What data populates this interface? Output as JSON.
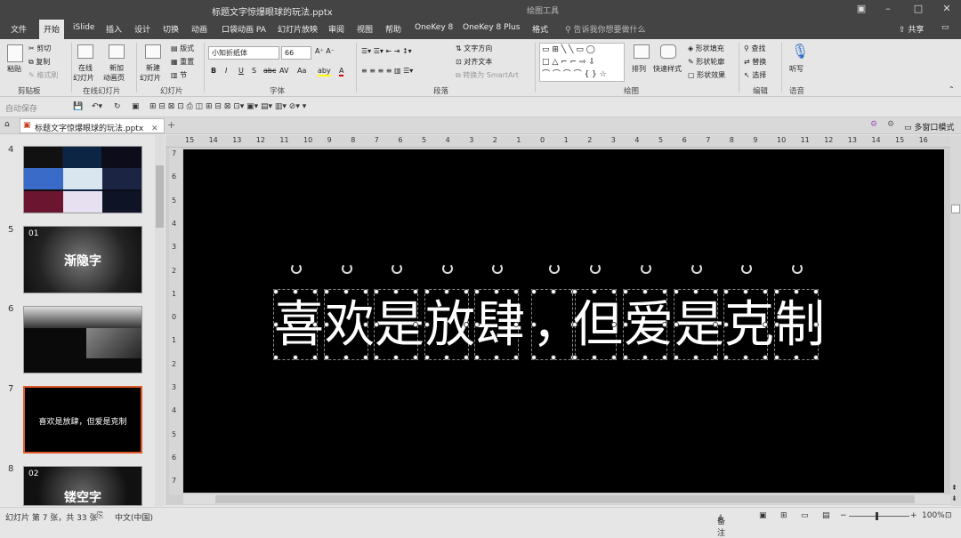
{
  "window": {
    "title": "标题文字惊爆眼球的玩法.pptx",
    "contextual_group": "绘图工具",
    "tell_me": "告诉我你想要做什么",
    "share": "共享"
  },
  "tabs": [
    "文件",
    "开始",
    "iSlide",
    "插入",
    "设计",
    "切换",
    "动画",
    "口袋动画 PA",
    "幻灯片放映",
    "审阅",
    "视图",
    "帮助",
    "OneKey 8",
    "OneKey 8 Plus",
    "格式"
  ],
  "ribbon": {
    "clipboard": {
      "label": "剪贴板",
      "paste": "粘贴",
      "cut": "剪切",
      "copy": "复制",
      "format_painter": "格式刷"
    },
    "online_slides": {
      "label": "在线幻灯片",
      "online_line1": "在线",
      "online_line2": "幻灯片",
      "new_anim_line1": "新加",
      "new_anim_line2": "动画页"
    },
    "slides": {
      "label": "幻灯片",
      "new_line1": "新建",
      "new_line2": "幻灯片",
      "layout": "版式",
      "reset": "重置",
      "section": "节"
    },
    "font": {
      "label": "字体",
      "font_name": "小知折纸体",
      "font_size": "66",
      "bold": "B",
      "italic": "I",
      "underline": "U",
      "shadow": "S",
      "strike": "abc",
      "spacing": "AV",
      "case": "Aa",
      "highlight": "aby",
      "color": "A"
    },
    "paragraph": {
      "label": "段落",
      "text_direction": "文字方向",
      "align_text": "对齐文本",
      "smartart": "转换为 SmartArt"
    },
    "drawing": {
      "label": "绘图",
      "arrange": "排列",
      "quick_styles": "快速样式",
      "fill": "形状填充",
      "outline": "形状轮廓",
      "effects": "形状效果"
    },
    "editing": {
      "label": "编辑",
      "find": "查找",
      "replace": "替换",
      "select": "选择"
    },
    "voice": {
      "label": "语音",
      "dictate": "听写"
    }
  },
  "qat": {
    "autosave": "自动保存"
  },
  "doc_tab": {
    "file": "标题文字惊爆眼球的玩法.pptx",
    "multi_window": "多窗口模式"
  },
  "thumbnails": [
    {
      "num": "4"
    },
    {
      "num": "5",
      "tag": "01",
      "title": "渐隐字"
    },
    {
      "num": "6"
    },
    {
      "num": "7",
      "title": "喜欢是放肆，但爱是克制"
    },
    {
      "num": "8",
      "tag": "02",
      "title": "镂空字"
    }
  ],
  "ruler": {
    "h_ticks": [
      "15",
      "14",
      "13",
      "12",
      "11",
      "10",
      "9",
      "8",
      "7",
      "6",
      "5",
      "4",
      "3",
      "2",
      "1",
      "0",
      "1",
      "2",
      "3",
      "4",
      "5",
      "6",
      "7",
      "8",
      "9",
      "10",
      "11",
      "12",
      "13",
      "14",
      "15",
      "16"
    ],
    "v_ticks": [
      "7",
      "6",
      "5",
      "4",
      "3",
      "2",
      "1",
      "0",
      "1",
      "2",
      "3",
      "4",
      "5",
      "6",
      "7"
    ]
  },
  "slide": {
    "chars": [
      "喜",
      "欢",
      "是",
      "放",
      "肆",
      "，",
      "但",
      "爱",
      "是",
      "克",
      "制"
    ]
  },
  "status": {
    "slide_info": "幻灯片 第 7 张，共 33 张",
    "language": "中文(中国)",
    "notes": "备注",
    "zoom": "100%"
  },
  "colors": {
    "accent": "#e05a2a",
    "ribbon_dark": "#444444",
    "slide_bg": "#000000"
  }
}
